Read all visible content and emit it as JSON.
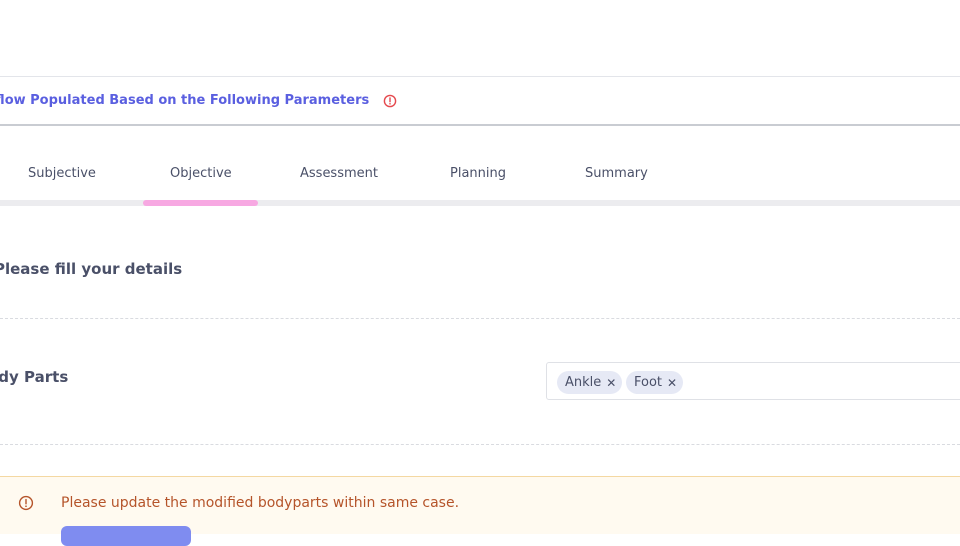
{
  "workflow": {
    "text": "rkflow Populated Based on the Following Parameters",
    "icon": "alert-circle-icon",
    "accent": "#5a5fe0",
    "icon_color": "#e5484d"
  },
  "tabs": [
    {
      "label": "Subjective"
    },
    {
      "label": "Objective",
      "active": true
    },
    {
      "label": "Assessment"
    },
    {
      "label": "Planning"
    },
    {
      "label": "Summary"
    }
  ],
  "tab_indicator_color": "#f7a8e2",
  "form": {
    "title": "Please fill your details",
    "body_parts": {
      "label": "ody Parts",
      "selected": [
        {
          "label": "Ankle",
          "remove_icon": "close-icon"
        },
        {
          "label": "Foot",
          "remove_icon": "close-icon"
        }
      ]
    }
  },
  "alert": {
    "icon": "alert-circle-icon",
    "text": "Please update the modified bodyparts within same case.",
    "text_color": "#b5542a",
    "background": "#fffaf0",
    "button_color": "#7f8cf0"
  }
}
